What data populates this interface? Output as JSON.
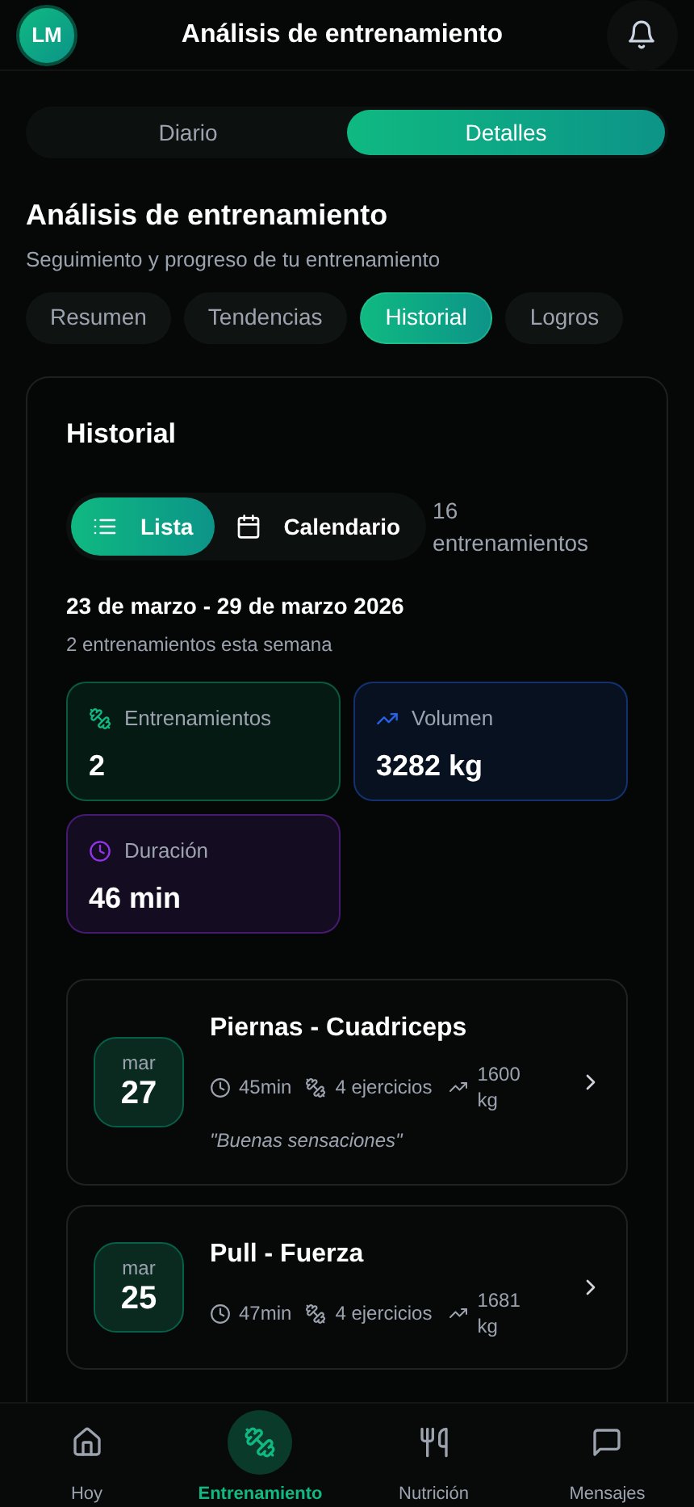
{
  "header": {
    "avatar": "LM",
    "title": "Análisis de entrenamiento"
  },
  "view_toggle": [
    {
      "label": "Diario",
      "selected": false
    },
    {
      "label": "Detalles",
      "selected": true
    }
  ],
  "page": {
    "title": "Análisis de entrenamiento",
    "subtitle": "Seguimiento y progreso de tu entrenamiento"
  },
  "tabs": [
    {
      "label": "Resumen",
      "selected": false
    },
    {
      "label": "Tendencias",
      "selected": false
    },
    {
      "label": "Historial",
      "selected": true
    },
    {
      "label": "Logros",
      "selected": false
    }
  ],
  "history": {
    "title": "Historial",
    "modes": [
      {
        "kind": "list",
        "label": "Lista",
        "selected": true
      },
      {
        "kind": "calendar",
        "label": "Calendario",
        "selected": false
      }
    ],
    "count": "16 entrenamientos",
    "week": {
      "range": "23 de marzo - 29 de marzo 2026",
      "summary": "2 entrenamientos esta semana",
      "stats": [
        {
          "kind": "workouts",
          "label": "Entrenamientos",
          "value": "2",
          "color": "#10b981"
        },
        {
          "kind": "volume",
          "label": "Volumen",
          "value": "3282 kg",
          "color": "#2563eb"
        },
        {
          "kind": "duration",
          "label": "Duración",
          "value": "46 min",
          "color": "#9333ea"
        }
      ],
      "workouts": [
        {
          "month": "mar",
          "day": "27",
          "name": "Piernas - Cuadriceps",
          "duration": "45min",
          "exercises": "4 ejercicios",
          "volume": "1600 kg",
          "note": "\"Buenas sensaciones\""
        },
        {
          "month": "mar",
          "day": "25",
          "name": "Pull - Fuerza",
          "duration": "47min",
          "exercises": "4 ejercicios",
          "volume": "1681 kg"
        }
      ]
    }
  },
  "nav": [
    {
      "kind": "home",
      "label": "Hoy",
      "selected": false
    },
    {
      "kind": "training",
      "label": "Entrenamiento",
      "selected": true
    },
    {
      "kind": "nutrition",
      "label": "Nutrición",
      "selected": false
    },
    {
      "kind": "messages",
      "label": "Mensajes",
      "selected": false
    }
  ]
}
